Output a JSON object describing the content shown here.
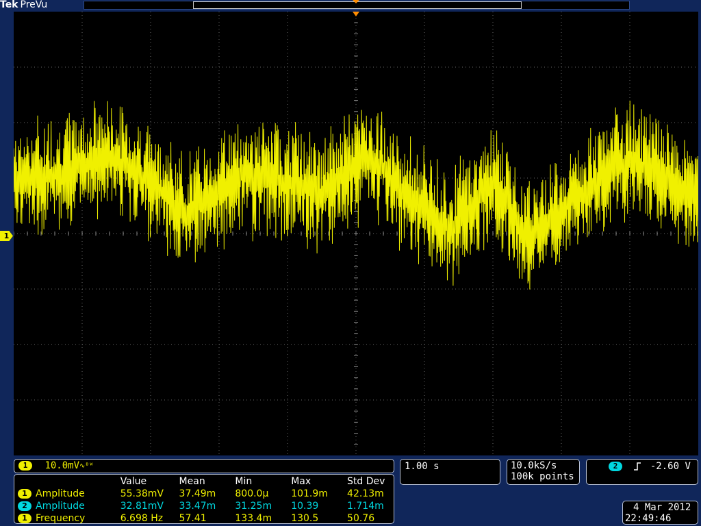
{
  "header": {
    "brand": "Tek",
    "mode": "PreVu"
  },
  "channel1": {
    "marker": "1",
    "scale": "10.0mV",
    "coupling_icon": "∿ᴮᵂ"
  },
  "timebase": {
    "value": "1.00 s"
  },
  "acquisition": {
    "sample_rate": "10.0kS/s",
    "record_length": "100k points"
  },
  "trigger": {
    "source": "2",
    "slope_icon": "rising-edge-icon",
    "level": "-2.60 V"
  },
  "datetime": {
    "date": "4 Mar 2012",
    "time": "22:49:46"
  },
  "measurements": {
    "headers": [
      "Value",
      "Mean",
      "Min",
      "Max",
      "Std Dev"
    ],
    "rows": [
      {
        "ch": "1",
        "name": "Amplitude",
        "value": "55.38mV",
        "mean": "37.49m",
        "min": "800.0µ",
        "max": "101.9m",
        "std": "42.13m"
      },
      {
        "ch": "2",
        "name": "Amplitude",
        "value": "32.81mV",
        "mean": "33.47m",
        "min": "31.25m",
        "max": "10.39",
        "std": "1.714m"
      },
      {
        "ch": "1",
        "name": "Frequency",
        "value": "6.698 Hz",
        "mean": "57.41",
        "min": "133.4m",
        "max": "130.5",
        "std": "50.76"
      }
    ]
  },
  "colors": {
    "ch1": "#f0f000",
    "ch2": "#00d8e0",
    "background": "#10265a",
    "trigger_marker": "#ff8c00"
  }
}
